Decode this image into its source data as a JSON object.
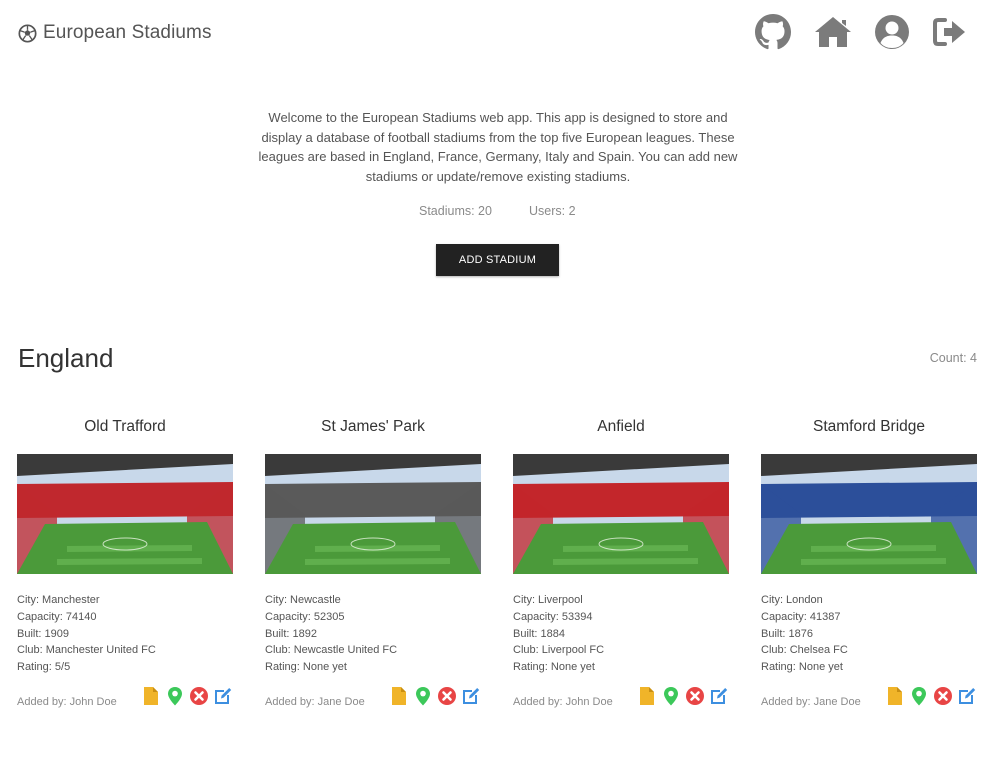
{
  "app": {
    "title": "European Stadiums",
    "icons": [
      "soccer-ball-icon",
      "github-icon",
      "home-icon",
      "user-circle-icon",
      "logout-icon"
    ]
  },
  "intro": {
    "text": "Welcome to the European Stadiums web app. This app is designed to store and display a database of football stadiums from the top five European leagues. These leagues are based in England, France, Germany, Italy and Spain. You can add new stadiums or update/remove existing stadiums.",
    "stadiums_label": "Stadiums: 20",
    "users_label": "Users: 2",
    "add_button": "ADD STADIUM"
  },
  "section": {
    "title": "England",
    "count": "Count: 4"
  },
  "stadiums": [
    {
      "name": "Old Trafford",
      "city": "City: Manchester",
      "capacity": "Capacity: 74140",
      "built": "Built: 1909",
      "club": "Club: Manchester United FC",
      "rating": "Rating: 5/5",
      "added_by": "Added by: John Doe",
      "seat_color": "#c0282e"
    },
    {
      "name": "St James' Park",
      "city": "City: Newcastle",
      "capacity": "Capacity: 52305",
      "built": "Built: 1892",
      "club": "Club: Newcastle United FC",
      "rating": "Rating: None yet",
      "added_by": "Added by: Jane Doe",
      "seat_color": "#5a5a5a"
    },
    {
      "name": "Anfield",
      "city": "City: Liverpool",
      "capacity": "Capacity: 53394",
      "built": "Built: 1884",
      "club": "Club: Liverpool FC",
      "rating": "Rating: None yet",
      "added_by": "Added by: John Doe",
      "seat_color": "#c3262b"
    },
    {
      "name": "Stamford Bridge",
      "city": "City: London",
      "capacity": "Capacity: 41387",
      "built": "Built: 1876",
      "club": "Club: Chelsea FC",
      "rating": "Rating: None yet",
      "added_by": "Added by: Jane Doe",
      "seat_color": "#2c4f9a"
    }
  ],
  "colors": {
    "doc_icon": "#f0b429",
    "map_pin_icon": "#3cc85a",
    "delete_icon": "#e84545",
    "edit_icon": "#3d8fe0",
    "nav_icons": "#7b7b7b",
    "button_bg": "#222222"
  }
}
